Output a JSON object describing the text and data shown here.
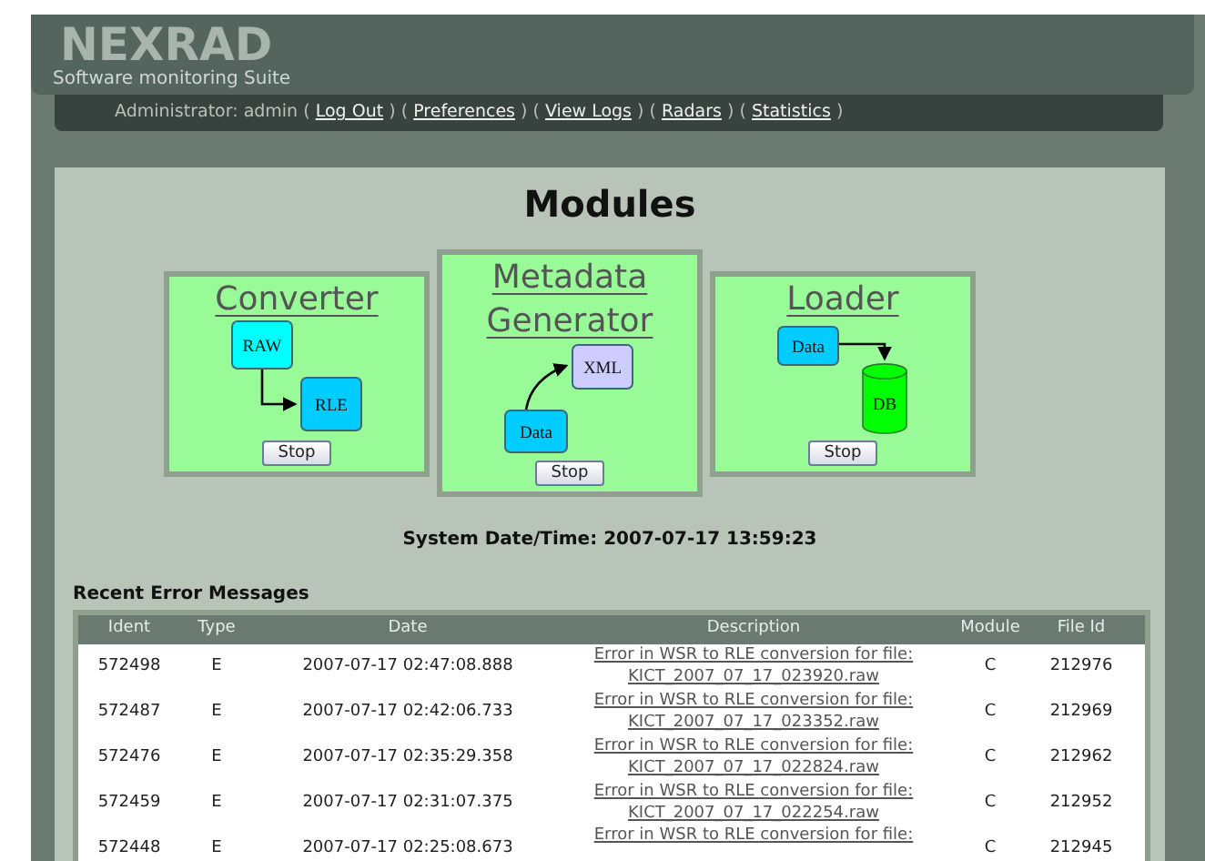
{
  "header": {
    "title": "NEXRAD",
    "subtitle": "Software monitoring Suite"
  },
  "nav": {
    "user_text": "Administrator: admin",
    "links": [
      {
        "open": "(",
        "label": "Log Out",
        "close": ")"
      },
      {
        "open": "(",
        "label": "Preferences",
        "close": ")"
      },
      {
        "open": "(",
        "label": "View Logs",
        "close": ")"
      },
      {
        "open": "(",
        "label": "Radars",
        "close": ")"
      },
      {
        "open": "(",
        "label": "Statistics",
        "close": ")"
      }
    ]
  },
  "page_title": "Modules",
  "modules": [
    {
      "title": [
        "Converter"
      ],
      "selected": false,
      "button": "Stop",
      "nodes": [
        {
          "kind": "box",
          "label": "RAW",
          "color": "#00ffff"
        },
        {
          "kind": "box",
          "label": "RLE",
          "color": "#00ccff"
        }
      ]
    },
    {
      "title": [
        "Metadata",
        "Generator"
      ],
      "selected": true,
      "button": "Stop",
      "nodes": [
        {
          "kind": "box",
          "label": "XML",
          "color": "#ccccff"
        },
        {
          "kind": "box",
          "label": "Data",
          "color": "#00ccff"
        }
      ]
    },
    {
      "title": [
        "Loader"
      ],
      "selected": false,
      "button": "Stop",
      "nodes": [
        {
          "kind": "box",
          "label": "Data",
          "color": "#00ccff"
        },
        {
          "kind": "cylinder",
          "label": "DB",
          "color": "#00ff00"
        }
      ]
    }
  ],
  "system_time": "System Date/Time: 2007-07-17 13:59:23",
  "errors": {
    "title": "Recent Error Messages",
    "columns": [
      "Ident",
      "Type",
      "Date",
      "Description",
      "Module",
      "File Id"
    ],
    "rows": [
      {
        "ident": "572498",
        "type": "E",
        "date": "2007-07-17 02:47:08.888",
        "description": [
          "Error in WSR to RLE conversion for file:",
          "KICT_2007_07_17_023920.raw"
        ],
        "module": "C",
        "file_id": "212976"
      },
      {
        "ident": "572487",
        "type": "E",
        "date": "2007-07-17 02:42:06.733",
        "description": [
          "Error in WSR to RLE conversion for file:",
          "KICT_2007_07_17_023352.raw"
        ],
        "module": "C",
        "file_id": "212969"
      },
      {
        "ident": "572476",
        "type": "E",
        "date": "2007-07-17 02:35:29.358",
        "description": [
          "Error in WSR to RLE conversion for file:",
          "KICT_2007_07_17_022824.raw"
        ],
        "module": "C",
        "file_id": "212962"
      },
      {
        "ident": "572459",
        "type": "E",
        "date": "2007-07-17 02:31:07.375",
        "description": [
          "Error in WSR to RLE conversion for file:",
          "KICT_2007_07_17_022254.raw"
        ],
        "module": "C",
        "file_id": "212952"
      },
      {
        "ident": "572448",
        "type": "E",
        "date": "2007-07-17 02:25:08.673",
        "description": [
          "Error in WSR to RLE conversion for file:"
        ],
        "module": "C",
        "file_id": "212945"
      }
    ]
  }
}
